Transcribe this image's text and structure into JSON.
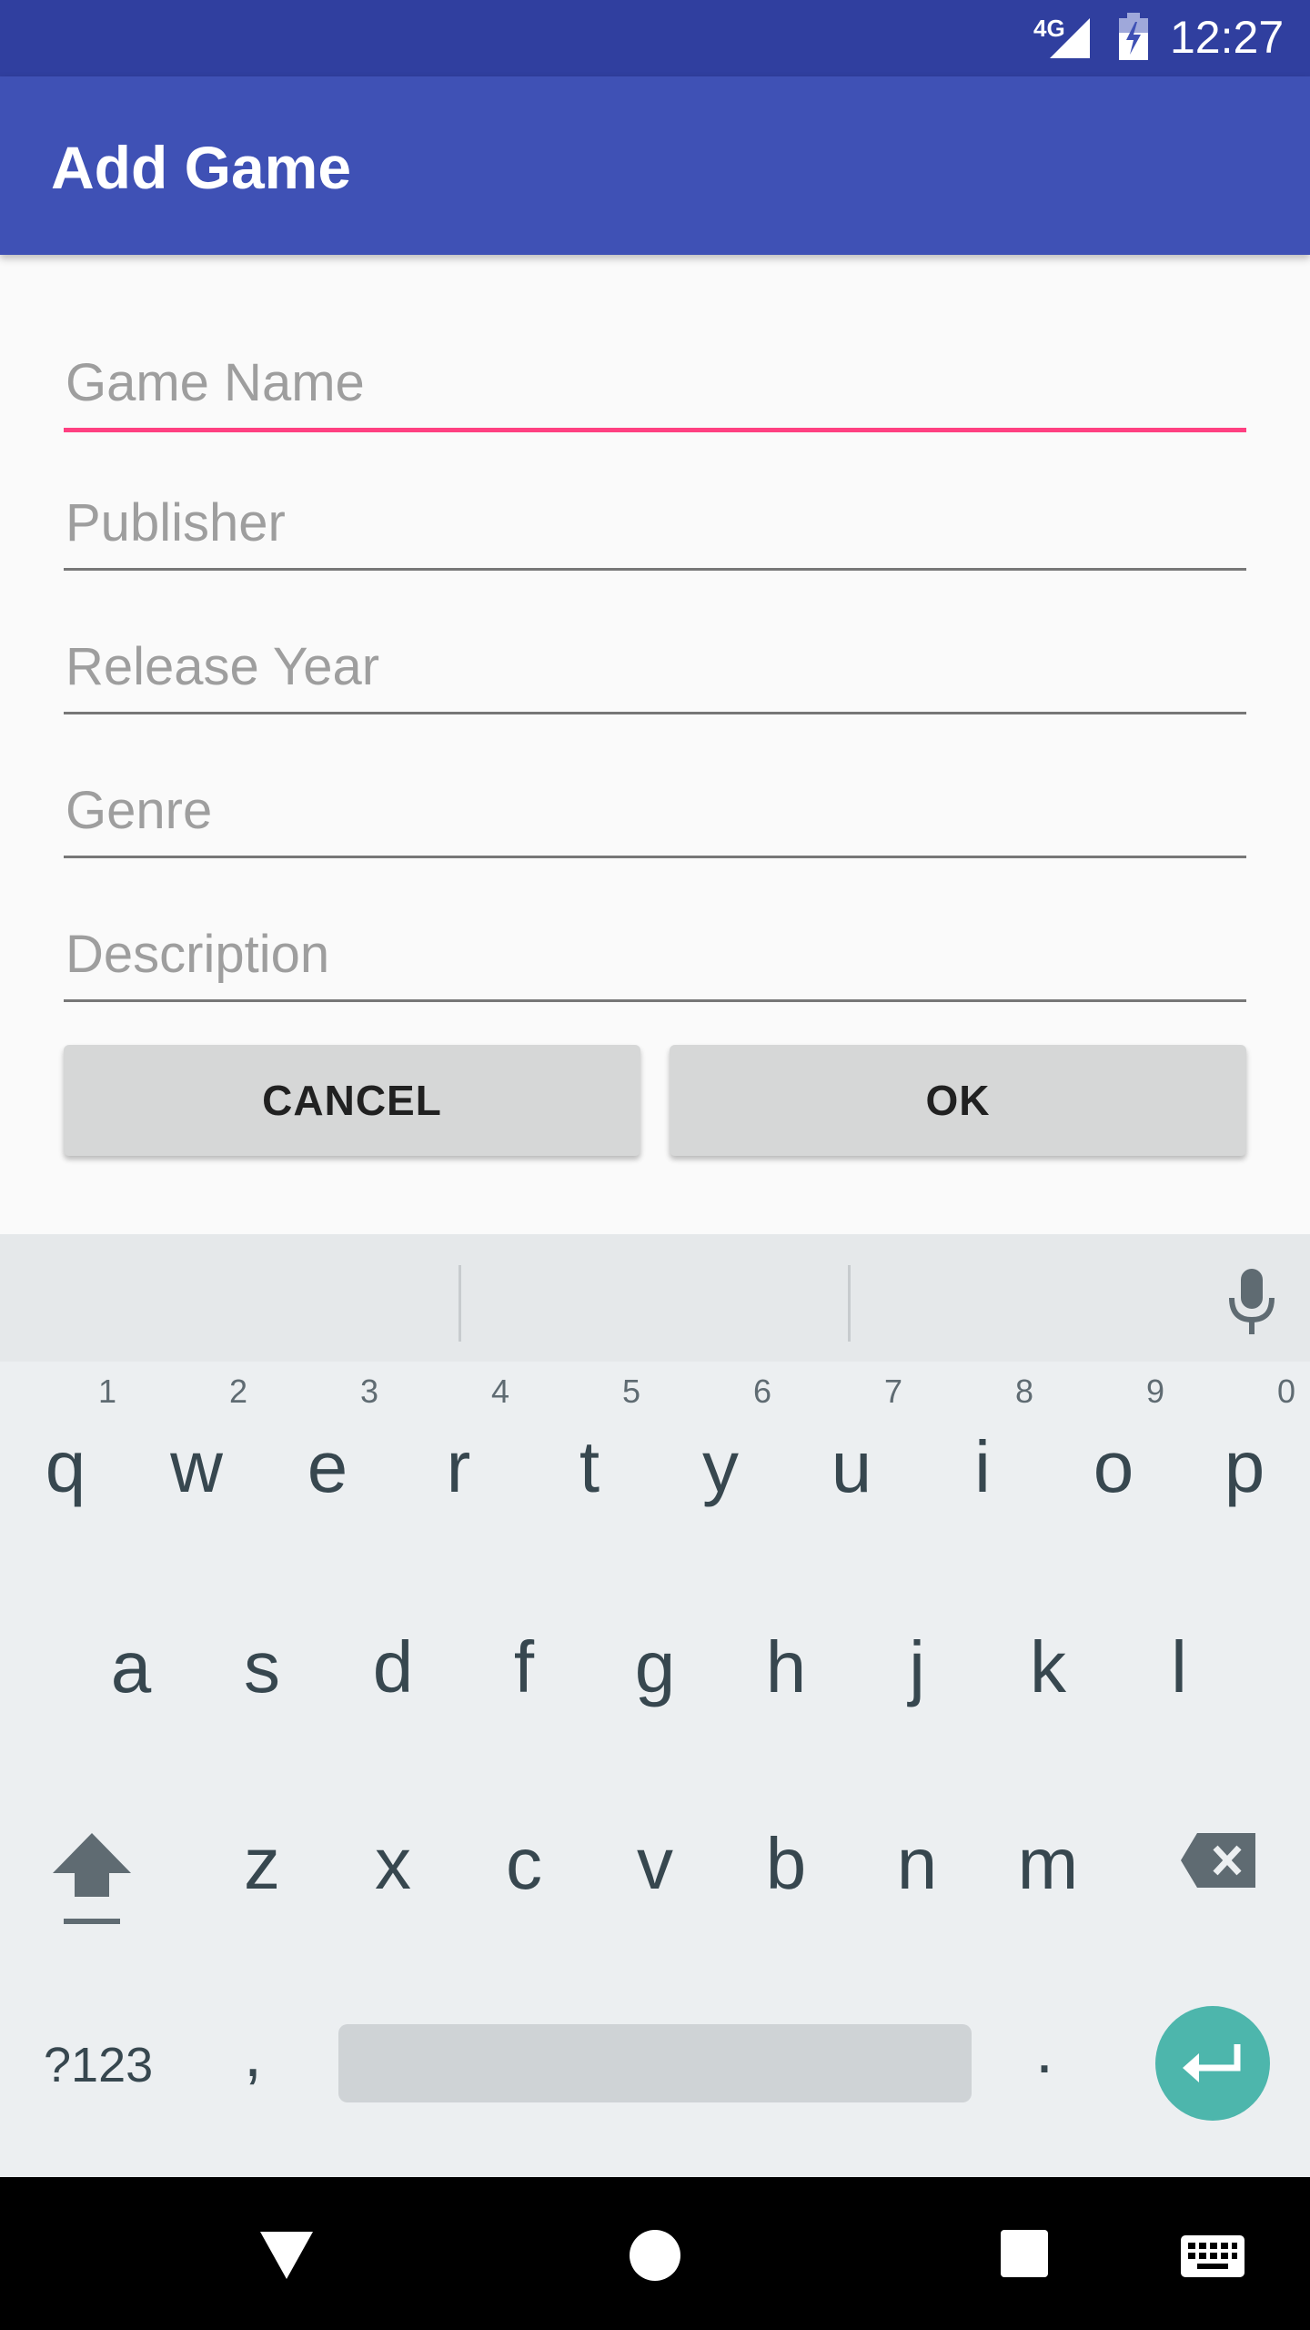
{
  "status_bar": {
    "network": "4G",
    "time": "12:27"
  },
  "app_bar": {
    "title": "Add Game"
  },
  "form": {
    "fields": [
      {
        "placeholder": "Game Name",
        "value": ""
      },
      {
        "placeholder": "Publisher",
        "value": ""
      },
      {
        "placeholder": "Release Year",
        "value": ""
      },
      {
        "placeholder": "Genre",
        "value": ""
      },
      {
        "placeholder": "Description",
        "value": ""
      }
    ],
    "cancel_label": "CANCEL",
    "ok_label": "OK"
  },
  "keyboard": {
    "row1": [
      {
        "key": "q",
        "hint": "1"
      },
      {
        "key": "w",
        "hint": "2"
      },
      {
        "key": "e",
        "hint": "3"
      },
      {
        "key": "r",
        "hint": "4"
      },
      {
        "key": "t",
        "hint": "5"
      },
      {
        "key": "y",
        "hint": "6"
      },
      {
        "key": "u",
        "hint": "7"
      },
      {
        "key": "i",
        "hint": "8"
      },
      {
        "key": "o",
        "hint": "9"
      },
      {
        "key": "p",
        "hint": "0"
      }
    ],
    "row2": [
      "a",
      "s",
      "d",
      "f",
      "g",
      "h",
      "j",
      "k",
      "l"
    ],
    "row3": [
      "z",
      "x",
      "c",
      "v",
      "b",
      "n",
      "m"
    ],
    "symbols_label": "?123",
    "comma": ",",
    "period": "."
  },
  "colors": {
    "status_bar": "#303f9f",
    "app_bar": "#3f51b5",
    "focus_underline": "#ff4081",
    "enter_key": "#4db6ac"
  }
}
